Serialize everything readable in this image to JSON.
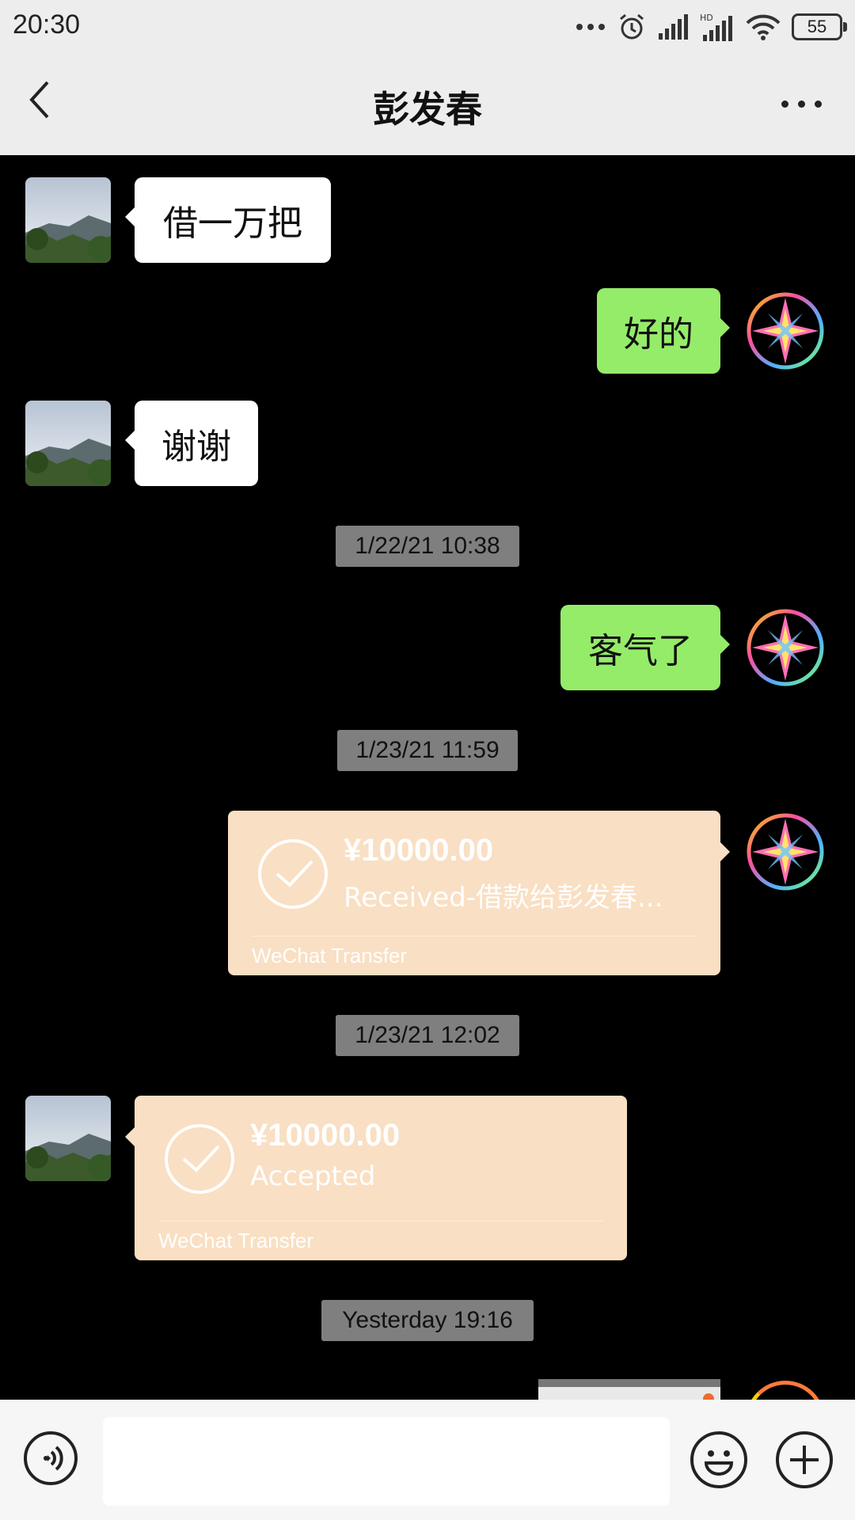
{
  "status_bar": {
    "time": "20:30",
    "battery": "55",
    "icons": [
      "more-dots-icon",
      "alarm-icon",
      "signal-icon",
      "hd-signal-icon",
      "wifi-icon",
      "battery-icon"
    ]
  },
  "header": {
    "title": "彭发春",
    "back_icon": "chevron-left-icon",
    "more_icon": "more-icon"
  },
  "messages": {
    "m1": {
      "text": "借一万把"
    },
    "m2": {
      "text": "好的"
    },
    "m3": {
      "text": "谢谢"
    },
    "ts1": "1/22/21 10:38",
    "m4": {
      "text": "客气了"
    },
    "ts2": "1/23/21 11:59",
    "transfer1": {
      "amount": "¥10000.00",
      "status": "Received-借款给彭发春...",
      "label": "WeChat Transfer"
    },
    "ts3": "1/23/21 12:02",
    "transfer2": {
      "amount": "¥10000.00",
      "status": "Accepted",
      "label": "WeChat Transfer"
    },
    "ts4": "Yesterday 19:16"
  },
  "input_bar": {
    "voice_icon": "voice-icon",
    "text_value": "",
    "emoji_icon": "emoji-icon",
    "add_icon": "plus-icon"
  },
  "colors": {
    "sent_bubble": "#95ec69",
    "received_bubble": "#ffffff",
    "transfer_bg": "#f9dfc3",
    "timestamp_bg": "#7f7f7f",
    "background": "#000000"
  }
}
